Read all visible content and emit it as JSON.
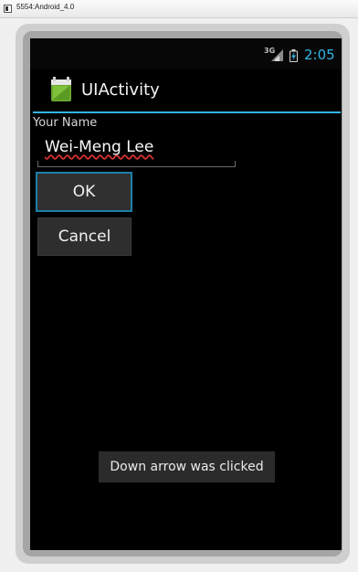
{
  "window": {
    "title": "5554:Android_4.0"
  },
  "status_bar": {
    "network_label": "3G",
    "time": "2:05",
    "time_color": "#33b5e5",
    "icons": [
      "signal-3g-icon",
      "battery-charging-icon"
    ]
  },
  "action_bar": {
    "title": "UIActivity",
    "icon": "app-launcher-icon",
    "accent_color": "#33b5e5"
  },
  "form": {
    "name_label": "Your Name",
    "name_value": "Wei-Meng Lee",
    "ok_label": "OK",
    "cancel_label": "Cancel"
  },
  "toast": {
    "message": "Down arrow was clicked"
  }
}
